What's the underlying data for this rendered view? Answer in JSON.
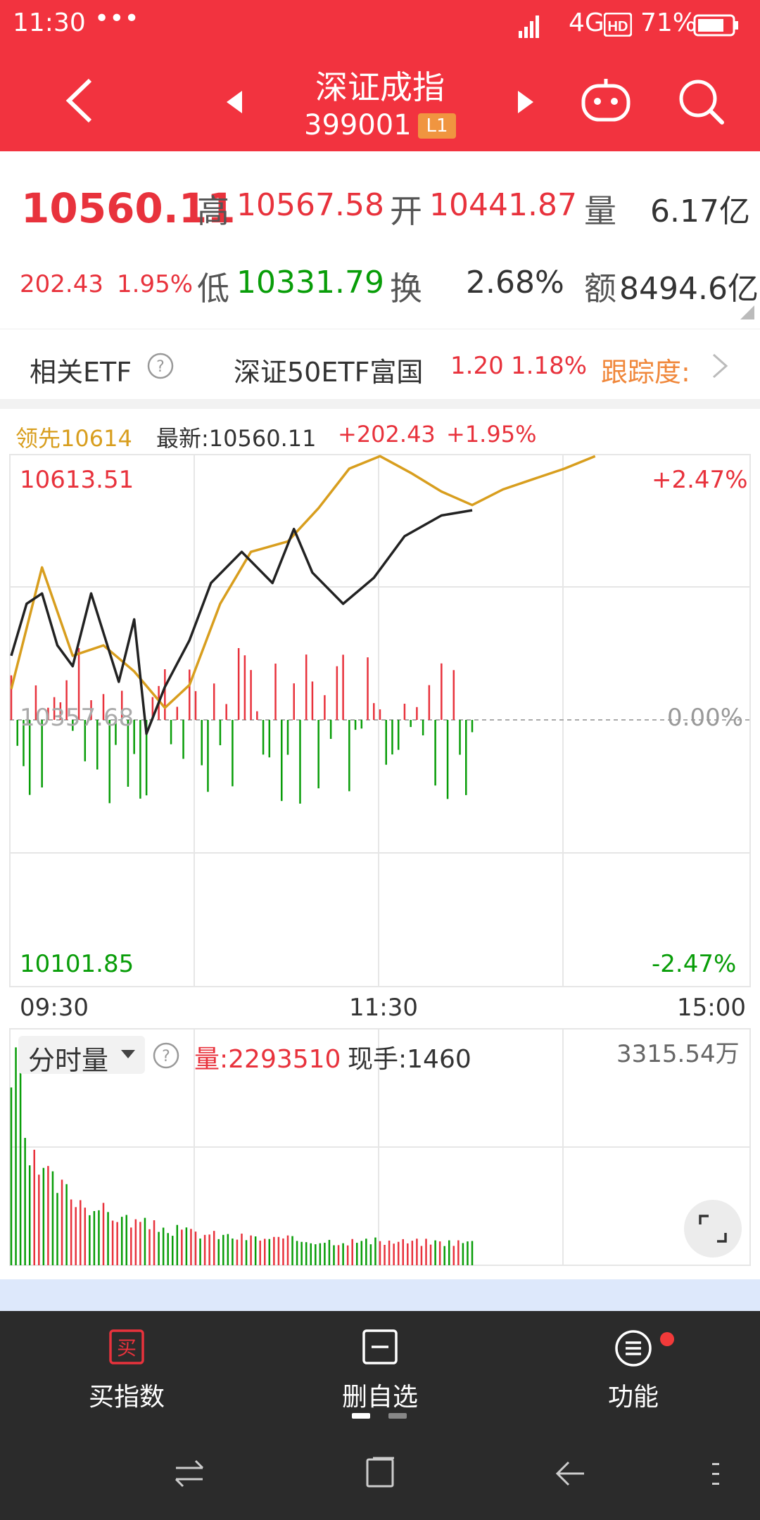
{
  "status_bar": {
    "time": "11:30",
    "more": "•••",
    "network": "4G",
    "battery": "71%"
  },
  "header": {
    "title": "深证成指",
    "code": "399001",
    "level_badge": "L1"
  },
  "quote": {
    "price": "10560.11",
    "change": "202.43",
    "change_pct": "1.95%",
    "high_label": "高",
    "high": "10567.58",
    "open_label": "开",
    "open": "10441.87",
    "volume_label": "量",
    "volume": "6.17亿",
    "low_label": "低",
    "low": "10331.79",
    "turnover_label": "换",
    "turnover": "2.68%",
    "amount_label": "额",
    "amount": "8494.6亿"
  },
  "etf": {
    "label": "相关ETF",
    "name": "深证50ETF富国",
    "price": "1.20",
    "pct": "1.18%",
    "track": "跟踪度:"
  },
  "chart_legend": {
    "leader": "领先10614",
    "latest": "最新:10560.11",
    "change": "+202.43",
    "pct": "+1.95%"
  },
  "chart_axes": {
    "y_top": "10613.51",
    "y_top_pct": "+2.47%",
    "y_mid": "10357.68",
    "y_mid_pct": "0.00%",
    "y_bottom": "10101.85",
    "y_bottom_pct": "-2.47%",
    "x_start": "09:30",
    "x_mid": "11:30",
    "x_end": "15:00"
  },
  "volume_panel": {
    "selector": "分时量",
    "volume_label": "量:2293510",
    "current_label": "现手:1460",
    "max_label": "3315.54万"
  },
  "bottom_nav": {
    "buy_icon_char": "买",
    "buy": "买指数",
    "remove": "删自选",
    "functions": "功能"
  },
  "colors": {
    "header_red": "#f2333f",
    "up": "#e8323c",
    "down": "#089d08",
    "leader_line": "#d89e1e",
    "price_line": "#222222",
    "nav_bg": "#2b2b2b"
  },
  "chart_data": {
    "type": "line",
    "x_range": [
      "09:30",
      "15:00"
    ],
    "ylim": [
      10101.85,
      10613.51
    ],
    "series": [
      {
        "name": "领先",
        "points": [
          [
            0,
            10388
          ],
          [
            10,
            10505
          ],
          [
            20,
            10420
          ],
          [
            30,
            10430
          ],
          [
            40,
            10405
          ],
          [
            50,
            10370
          ],
          [
            58,
            10392
          ],
          [
            68,
            10470
          ],
          [
            78,
            10520
          ],
          [
            90,
            10530
          ],
          [
            100,
            10562
          ],
          [
            110,
            10600
          ],
          [
            120,
            10612
          ],
          [
            130,
            10596
          ],
          [
            140,
            10578
          ],
          [
            150,
            10565
          ],
          [
            160,
            10580
          ],
          [
            170,
            10590
          ],
          [
            180,
            10600
          ],
          [
            190,
            10612
          ]
        ]
      },
      {
        "name": "最新",
        "points": [
          [
            0,
            10420
          ],
          [
            5,
            10470
          ],
          [
            10,
            10480
          ],
          [
            15,
            10430
          ],
          [
            20,
            10410
          ],
          [
            26,
            10480
          ],
          [
            35,
            10395
          ],
          [
            40,
            10455
          ],
          [
            44,
            10345
          ],
          [
            50,
            10390
          ],
          [
            58,
            10435
          ],
          [
            65,
            10490
          ],
          [
            75,
            10520
          ],
          [
            85,
            10490
          ],
          [
            92,
            10542
          ],
          [
            98,
            10500
          ],
          [
            108,
            10470
          ],
          [
            118,
            10495
          ],
          [
            128,
            10535
          ],
          [
            140,
            10555
          ],
          [
            150,
            10560
          ]
        ]
      }
    ]
  }
}
